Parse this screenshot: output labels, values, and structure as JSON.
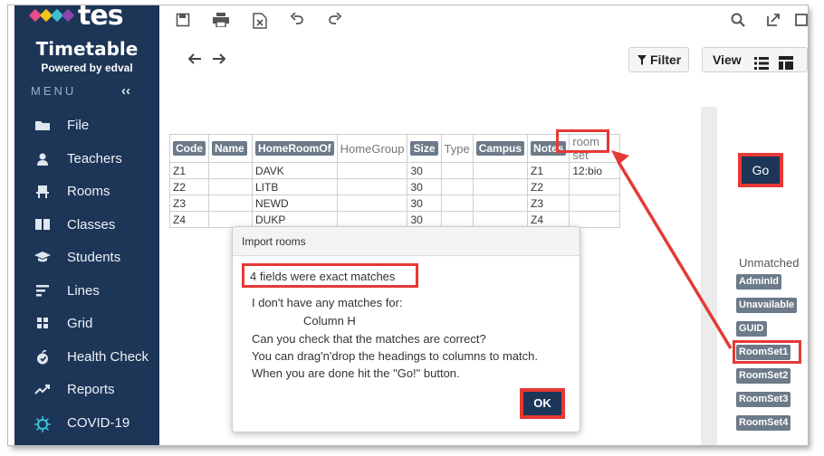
{
  "sidebar": {
    "logo_text": "tes",
    "app_title": "Timetable",
    "powered_by": "Powered by edval",
    "menu_label": "MENU",
    "collapse_glyph": "‹‹",
    "items": [
      {
        "label": "File",
        "icon": "folder-icon"
      },
      {
        "label": "Teachers",
        "icon": "person-icon"
      },
      {
        "label": "Rooms",
        "icon": "chair-icon"
      },
      {
        "label": "Classes",
        "icon": "book-icon"
      },
      {
        "label": "Students",
        "icon": "graduation-cap-icon"
      },
      {
        "label": "Lines",
        "icon": "lines-icon"
      },
      {
        "label": "Grid",
        "icon": "grid-icon"
      },
      {
        "label": "Health Check",
        "icon": "apple-icon"
      },
      {
        "label": "Reports",
        "icon": "trend-icon"
      },
      {
        "label": "COVID-19",
        "icon": "virus-icon"
      }
    ]
  },
  "toolbar": {
    "filter_label": "Filter",
    "view_label": "View"
  },
  "table": {
    "headers": [
      "Code",
      "Name",
      "HomeRoomOf",
      "HomeGroup",
      "Size",
      "Type",
      "Campus",
      "Notes",
      "room set"
    ],
    "rows": [
      [
        "Z1",
        "",
        "DAVK",
        "",
        "30",
        "",
        "",
        "Z1",
        "12:bio"
      ],
      [
        "Z2",
        "",
        "LITB",
        "",
        "30",
        "",
        "",
        "Z2",
        ""
      ],
      [
        "Z3",
        "",
        "NEWD",
        "",
        "30",
        "",
        "",
        "Z3",
        ""
      ],
      [
        "Z4",
        "",
        "DUKP",
        "",
        "30",
        "",
        "",
        "Z4",
        ""
      ]
    ]
  },
  "dialog": {
    "title": "Import rooms",
    "highlight": "4 fields were exact matches",
    "line1": "I don't have any matches for:",
    "column": "Column H",
    "line2": "Can you check that the matches are correct?",
    "line3": "You can drag'n'drop the headings to columns to match.",
    "line4": "When you are done hit the \"Go!\" button.",
    "ok_label": "OK"
  },
  "right_panel": {
    "go_label": "Go",
    "unmatched_label": "Unmatched",
    "tags": [
      "AdminId",
      "Unavailable",
      "GUID",
      "RoomSet1",
      "RoomSet2",
      "RoomSet3",
      "RoomSet4"
    ]
  },
  "colors": {
    "sidebar_bg": "#1d3557",
    "header_tag": "#6c7a89",
    "highlight_red": "#e53935"
  }
}
